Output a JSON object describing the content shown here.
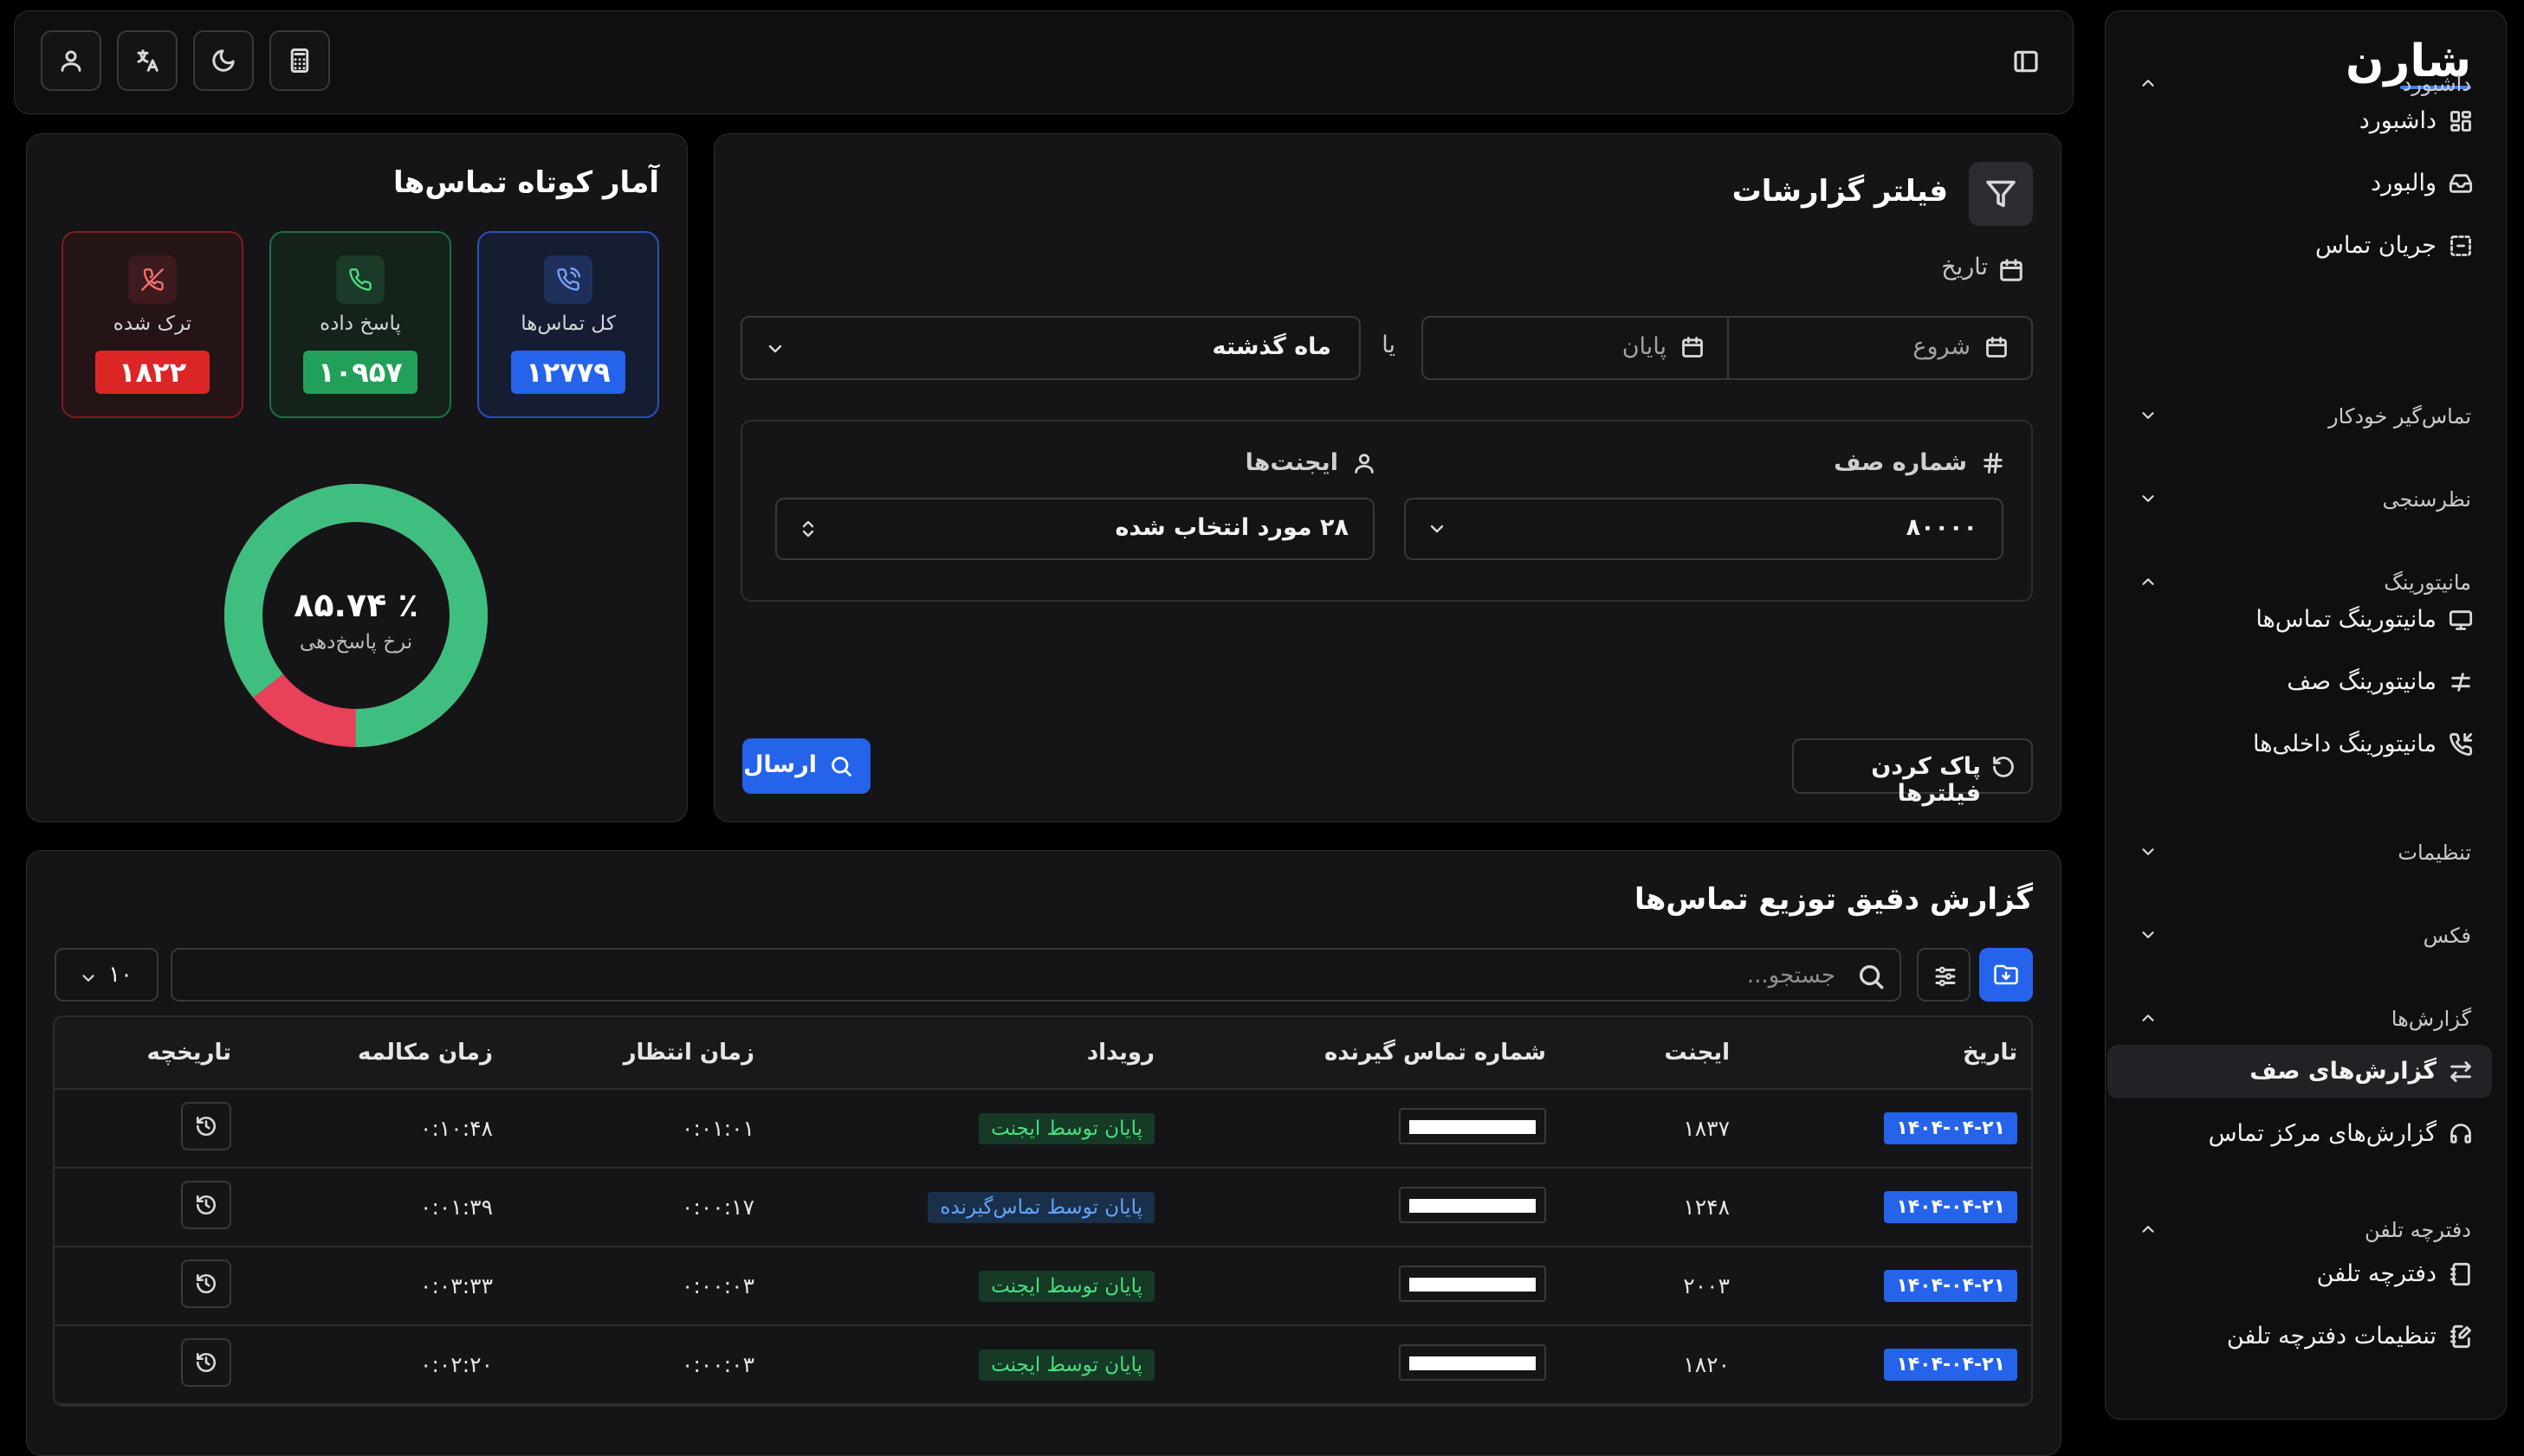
{
  "brand": {
    "logo": "شارن"
  },
  "sidebar": {
    "sections": [
      {
        "label": "داشبورد",
        "expanded": true,
        "items": [
          {
            "label": "داشبورد",
            "icon": "grid-icon"
          },
          {
            "label": "والبورد",
            "icon": "inbox-icon"
          },
          {
            "label": "جریان تماس",
            "icon": "flow-icon"
          }
        ]
      },
      {
        "label": "تماس‌گیر خودکار",
        "expanded": false,
        "items": []
      },
      {
        "label": "نظرسنجی",
        "expanded": false,
        "items": []
      },
      {
        "label": "مانیتورینگ",
        "expanded": true,
        "items": [
          {
            "label": "مانیتورینگ تماس‌ها",
            "icon": "monitor-call-icon"
          },
          {
            "label": "مانیتورینگ صف",
            "icon": "queue-icon"
          },
          {
            "label": "مانیتورینگ داخلی‌ها",
            "icon": "phone-incoming-icon"
          }
        ]
      },
      {
        "label": "تنظیمات",
        "expanded": false,
        "items": []
      },
      {
        "label": "فکس",
        "expanded": false,
        "items": []
      },
      {
        "label": "گزارش‌ها",
        "expanded": true,
        "items": [
          {
            "label": "گزارش‌های صف",
            "icon": "arrows-swap-icon",
            "active": true
          },
          {
            "label": "گزارش‌های مرکز تماس",
            "icon": "headset-icon"
          }
        ]
      },
      {
        "label": "دفترچه تلفن",
        "expanded": true,
        "items": [
          {
            "label": "دفترچه تلفن",
            "icon": "book-icon"
          },
          {
            "label": "تنظیمات دفترچه تلفن",
            "icon": "book-edit-icon"
          }
        ]
      }
    ]
  },
  "topbar": {
    "buttons": [
      "user-icon",
      "translate-icon",
      "moon-icon",
      "calculator-icon"
    ],
    "toggle": "sidebar-toggle-icon"
  },
  "filter": {
    "title": "فیلتر گزارشات",
    "date_label": "تاریخ",
    "start_placeholder": "شروع",
    "end_placeholder": "پایان",
    "or_label": "یا",
    "period_value": "ماه گذشته",
    "queue_label": "شماره صف",
    "queue_value": "۸۰۰۰۰",
    "agents_label": "ایجنت‌ها",
    "agents_value": "۲۸ مورد انتخاب شده",
    "clear_label": "پاک کردن فیلترها",
    "send_label": "ارسال"
  },
  "stats": {
    "title": "آمار کوتاه تماس‌ها",
    "cards": [
      {
        "label": "کل تماس‌ها",
        "value": "۱۲۷۷۹",
        "color": "#2563eb",
        "icon": "phone-call-icon"
      },
      {
        "label": "پاسخ داده",
        "value": "۱۰۹۵۷",
        "color": "#22a05a",
        "icon": "phone-icon"
      },
      {
        "label": "ترک شده",
        "value": "۱۸۲۲",
        "color": "#dc2626",
        "icon": "phone-off-icon"
      }
    ],
    "answer_rate": 0.8574,
    "rate_text": "٪ ۸۵.۷۴",
    "rate_label": "نرخ پاسخ‌دهی",
    "colors": {
      "answered": "#3fbf7f",
      "abandoned": "#e8415a"
    }
  },
  "table": {
    "title": "گزارش دقیق توزیع تماس‌ها",
    "search_placeholder": "جستجو...",
    "page_size": "۱۰",
    "columns": {
      "date": "تاریخ",
      "agent": "ایجنت",
      "caller": "شماره تماس گیرنده",
      "event": "رویداد",
      "wait": "زمان انتظار",
      "talk": "زمان مکالمه",
      "history": "تاریخچه"
    },
    "rows": [
      {
        "date": "۱۴۰۴-۰۴-۲۱",
        "agent": "۱۸۳۷",
        "event": "پایان توسط ایجنت",
        "event_type": "agent",
        "wait": "۰:۰۱:۰۱",
        "talk": "۰:۱۰:۴۸"
      },
      {
        "date": "۱۴۰۴-۰۴-۲۱",
        "agent": "۱۲۴۸",
        "event": "پایان توسط تماس‌گیرنده",
        "event_type": "caller",
        "wait": "۰:۰۰:۱۷",
        "talk": "۰:۰۱:۳۹"
      },
      {
        "date": "۱۴۰۴-۰۴-۲۱",
        "agent": "۲۰۰۳",
        "event": "پایان توسط ایجنت",
        "event_type": "agent",
        "wait": "۰:۰۰:۰۳",
        "talk": "۰:۰۳:۳۳"
      },
      {
        "date": "۱۴۰۴-۰۴-۲۱",
        "agent": "۱۸۲۰",
        "event": "پایان توسط ایجنت",
        "event_type": "agent",
        "wait": "۰:۰۰:۰۳",
        "talk": "۰:۰۲:۲۰"
      }
    ]
  }
}
